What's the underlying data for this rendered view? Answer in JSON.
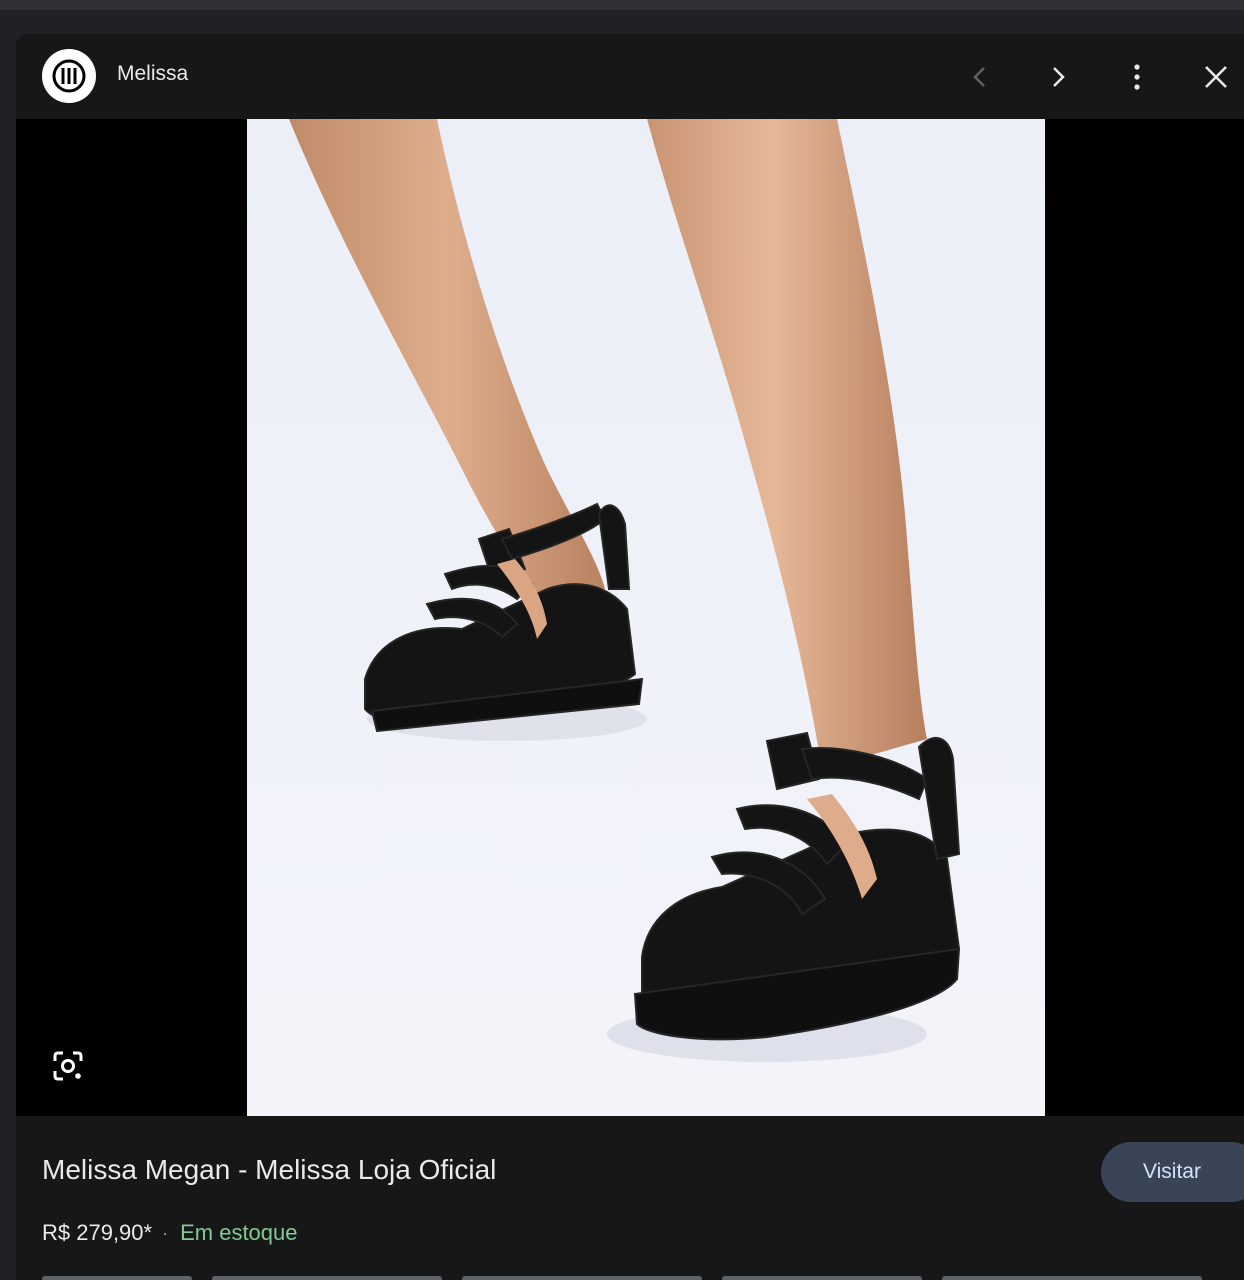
{
  "header": {
    "source_name": "Melissa",
    "logo_icon": "melissa-logo-icon",
    "prev_icon": "chevron-left-icon",
    "next_icon": "chevron-right-icon",
    "more_icon": "more-vert-icon",
    "close_icon": "close-icon"
  },
  "viewer": {
    "lens_icon": "google-lens-icon"
  },
  "info": {
    "title": "Melissa Megan - Melissa Loja Oficial",
    "visit_label": "Visitar",
    "price": "R$ 279,90*",
    "separator": "·",
    "stock": "Em estoque"
  },
  "colors": {
    "panel_bg": "#171717",
    "stage_bg": "#000000",
    "visit_bg": "#394457",
    "stock_green": "#81c995"
  }
}
